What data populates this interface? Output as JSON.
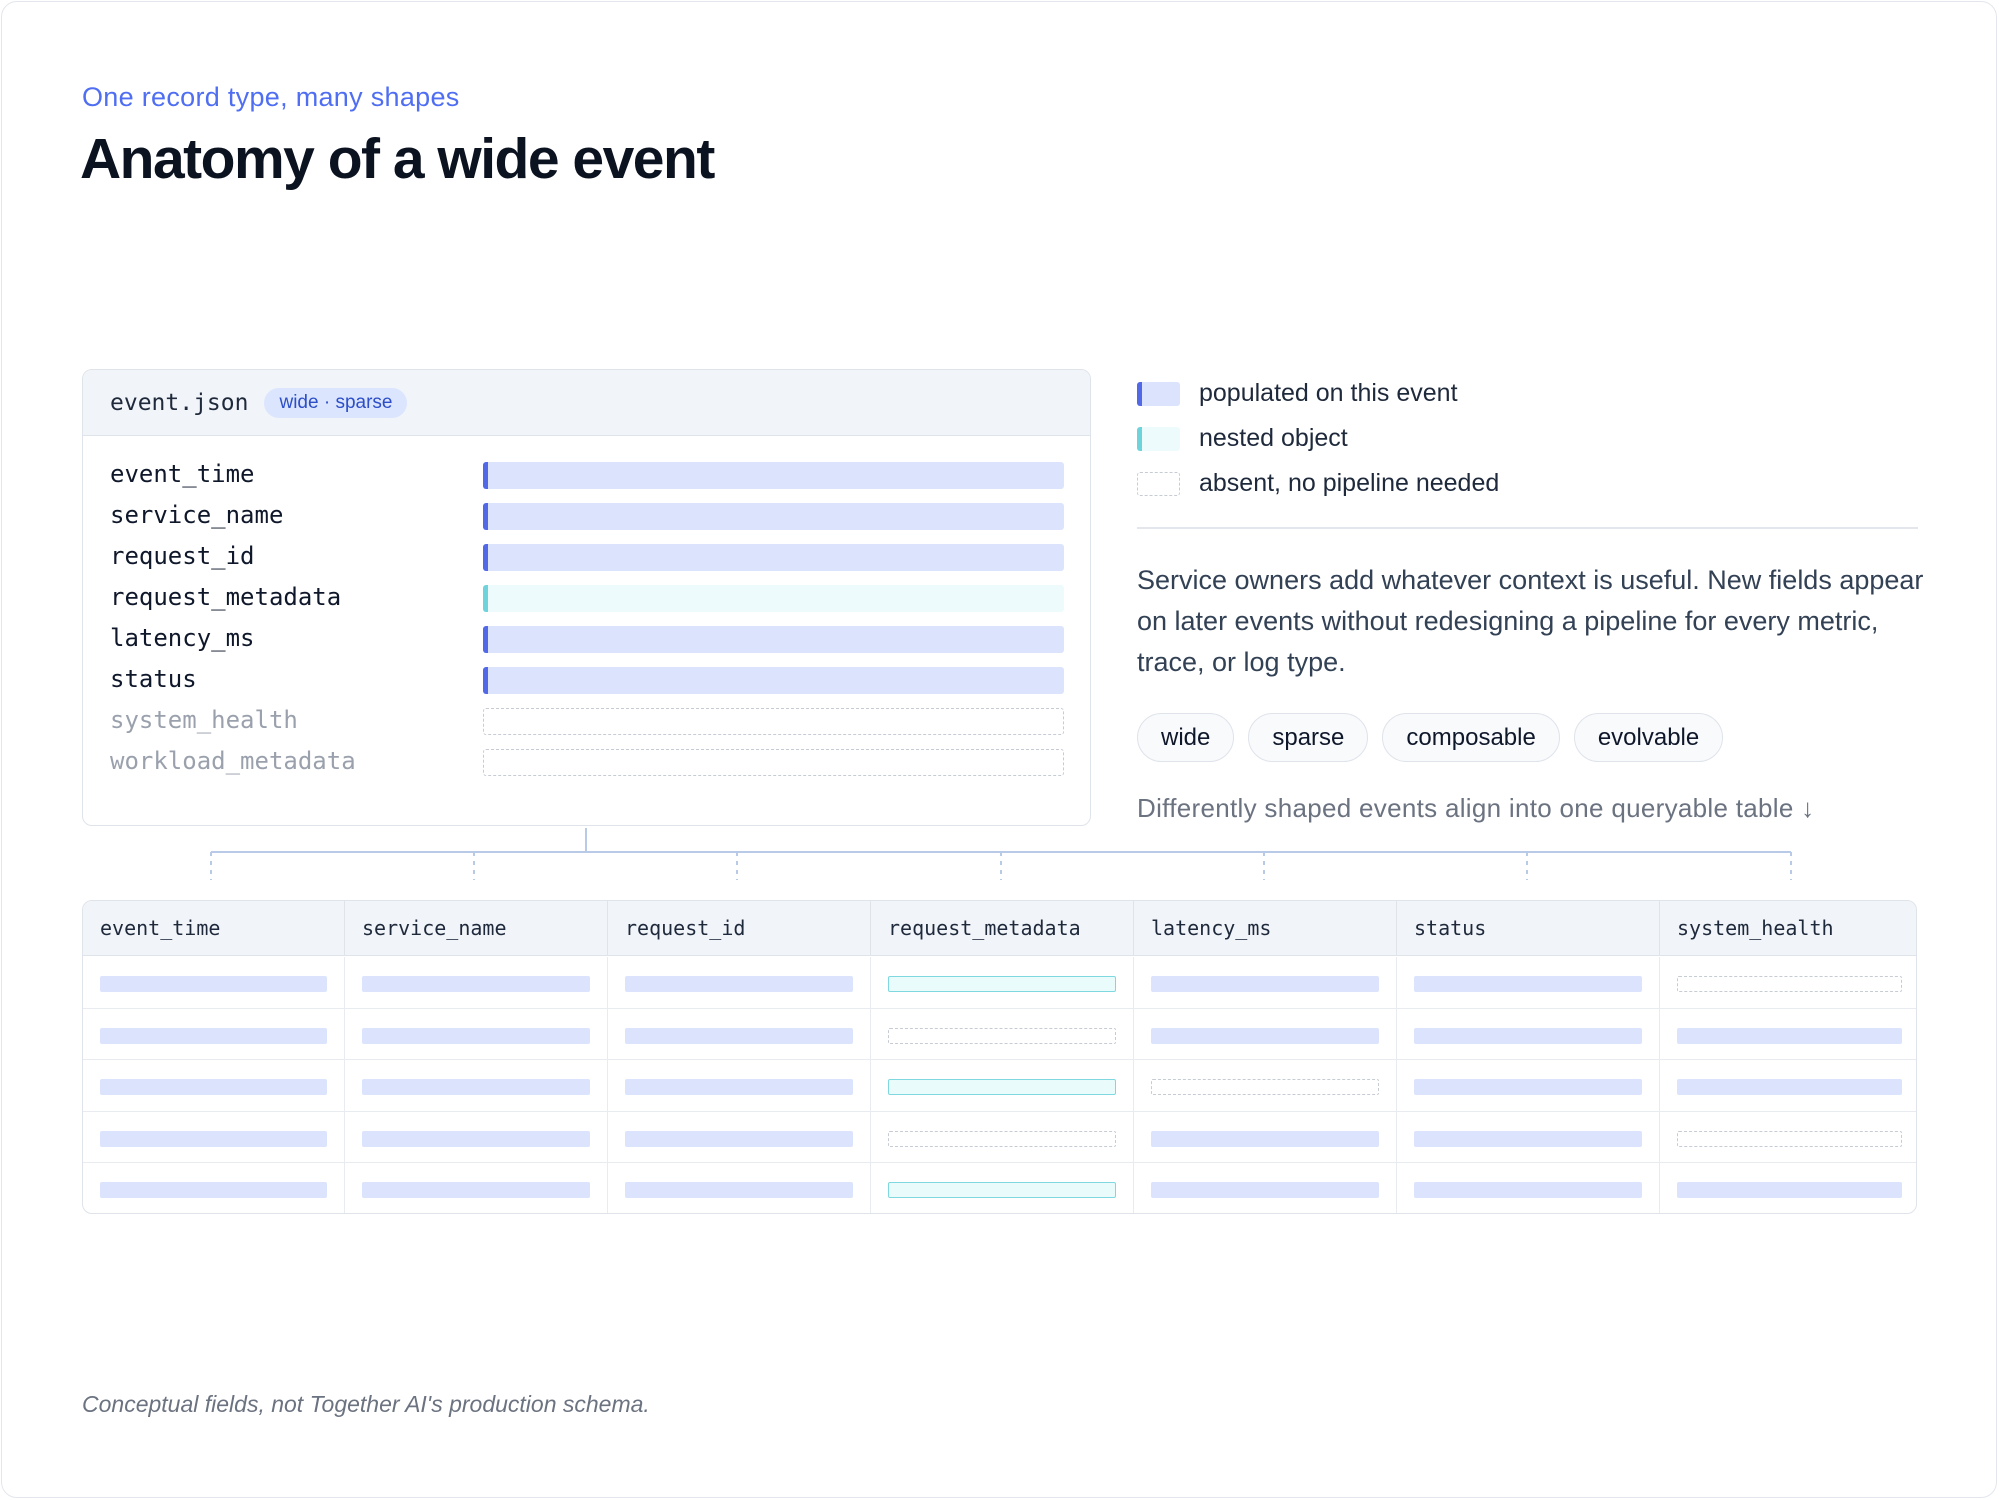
{
  "header": {
    "eyebrow": "One record type, many shapes",
    "title": "Anatomy of a wide event"
  },
  "event_card": {
    "filename": "event.json",
    "badge": "wide · sparse",
    "fields": [
      {
        "name": "event_time",
        "state": "populated"
      },
      {
        "name": "service_name",
        "state": "populated"
      },
      {
        "name": "request_id",
        "state": "populated"
      },
      {
        "name": "request_metadata",
        "state": "nested"
      },
      {
        "name": "latency_ms",
        "state": "populated"
      },
      {
        "name": "status",
        "state": "populated"
      },
      {
        "name": "system_health",
        "state": "absent"
      },
      {
        "name": "workload_metadata",
        "state": "absent"
      }
    ]
  },
  "legend": {
    "populated": "populated on this event",
    "nested": "nested object",
    "absent": "absent, no pipeline needed"
  },
  "description": "Service owners add whatever context is useful. New fields appear on later events without redesigning a pipeline for every metric, trace, or log type.",
  "tags": [
    "wide",
    "sparse",
    "composable",
    "evolvable"
  ],
  "caption": "Differently shaped events align into one queryable table ↓",
  "table": {
    "columns": [
      "event_time",
      "service_name",
      "request_id",
      "request_metadata",
      "latency_ms",
      "status",
      "system_health"
    ],
    "rows": [
      [
        "populated",
        "populated",
        "populated",
        "nested",
        "populated",
        "populated",
        "absent"
      ],
      [
        "populated",
        "populated",
        "populated",
        "absent",
        "populated",
        "populated",
        "populated"
      ],
      [
        "populated",
        "populated",
        "populated",
        "nested",
        "absent",
        "populated",
        "populated"
      ],
      [
        "populated",
        "populated",
        "populated",
        "absent",
        "populated",
        "populated",
        "absent"
      ],
      [
        "populated",
        "populated",
        "populated",
        "nested",
        "populated",
        "populated",
        "populated"
      ]
    ]
  },
  "footnote": "Conceptual fields, not Together AI's production schema.",
  "colors": {
    "accent": "#4f6ef2",
    "populated_fill": "#dce4fd",
    "populated_edge": "#5169e6",
    "nested_fill": "#eefbfc",
    "nested_edge": "#6fd3dc",
    "absent_border": "#c7ccd4"
  }
}
